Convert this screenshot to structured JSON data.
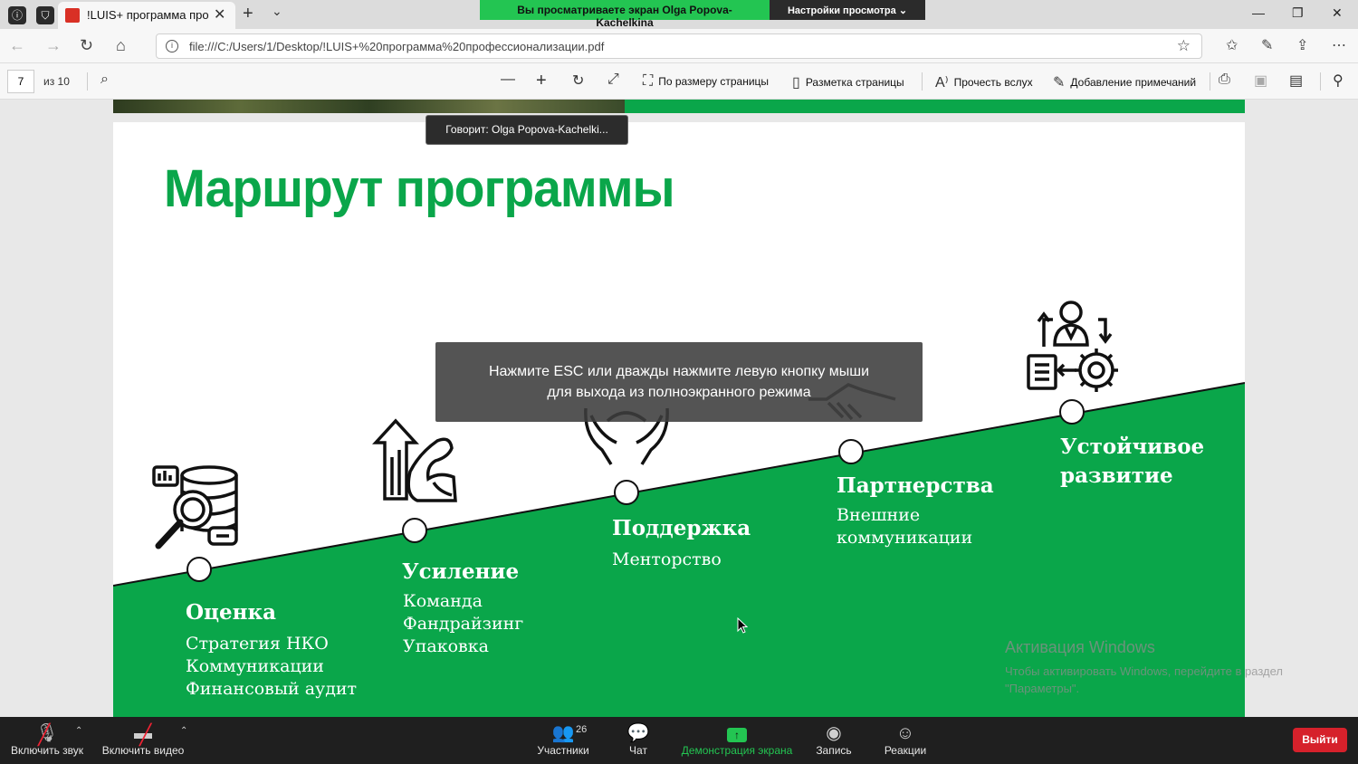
{
  "titlebar": {
    "tab_title": "!LUIS+ программа про",
    "share_banner_text": "Вы просматриваете экран Olga Popova-Kachelkina",
    "view_settings_label": "Настройки просмотра ⌄",
    "icons": [
      "info-icon",
      "shield-icon",
      "pdf-icon",
      "close-icon",
      "plus-icon",
      "chevron-down-icon",
      "minimize-icon",
      "restore-icon",
      "close-window-icon"
    ]
  },
  "address": {
    "url": "file:///C:/Users/1/Desktop/!LUIS+%20программа%20профессионализации.pdf"
  },
  "pdf_toolbar": {
    "page_number": "7",
    "page_total": "из 10",
    "fit_page": "По размеру страницы",
    "page_layout": "Разметка страницы",
    "read_aloud": "Прочесть вслух",
    "add_notes": "Добавление примечаний"
  },
  "speaker": "Говорит:  Olga  Popova-Kachelki...",
  "esc_overlay": {
    "line1": "Нажмите ESC или дважды нажмите левую кнопку мыши",
    "line2": "для выхода из полноэкранного режима"
  },
  "slide": {
    "title": "Маршрут программы",
    "accent_color": "#0aa64a",
    "stages": [
      {
        "title": "Оценка",
        "items": [
          "Стратегия НКО",
          "Коммуникации",
          "Финансовый аудит"
        ]
      },
      {
        "title": "Усиление",
        "items": [
          "Команда",
          "Фандрайзинг",
          "Упаковка"
        ]
      },
      {
        "title": "Поддержка",
        "items": [
          "Менторство"
        ]
      },
      {
        "title": "Партнерства",
        "items": [
          "Внешние",
          "коммуникации"
        ]
      },
      {
        "title": "Устойчивое",
        "title2": "развитие",
        "items": []
      }
    ]
  },
  "windows_activation": {
    "title": "Активация Windows",
    "line1": "Чтобы активировать Windows, перейдите в раздел",
    "line2": "\"Параметры\"."
  },
  "zoom": {
    "unmute": "Включить звук",
    "start_video": "Включить видео",
    "participants": "Участники",
    "participants_count": "26",
    "chat": "Чат",
    "share_screen": "Демонстрация экрана",
    "record": "Запись",
    "reactions": "Реакции",
    "leave": "Выйти",
    "share_color": "#23c552",
    "leave_color": "#d6212b"
  }
}
